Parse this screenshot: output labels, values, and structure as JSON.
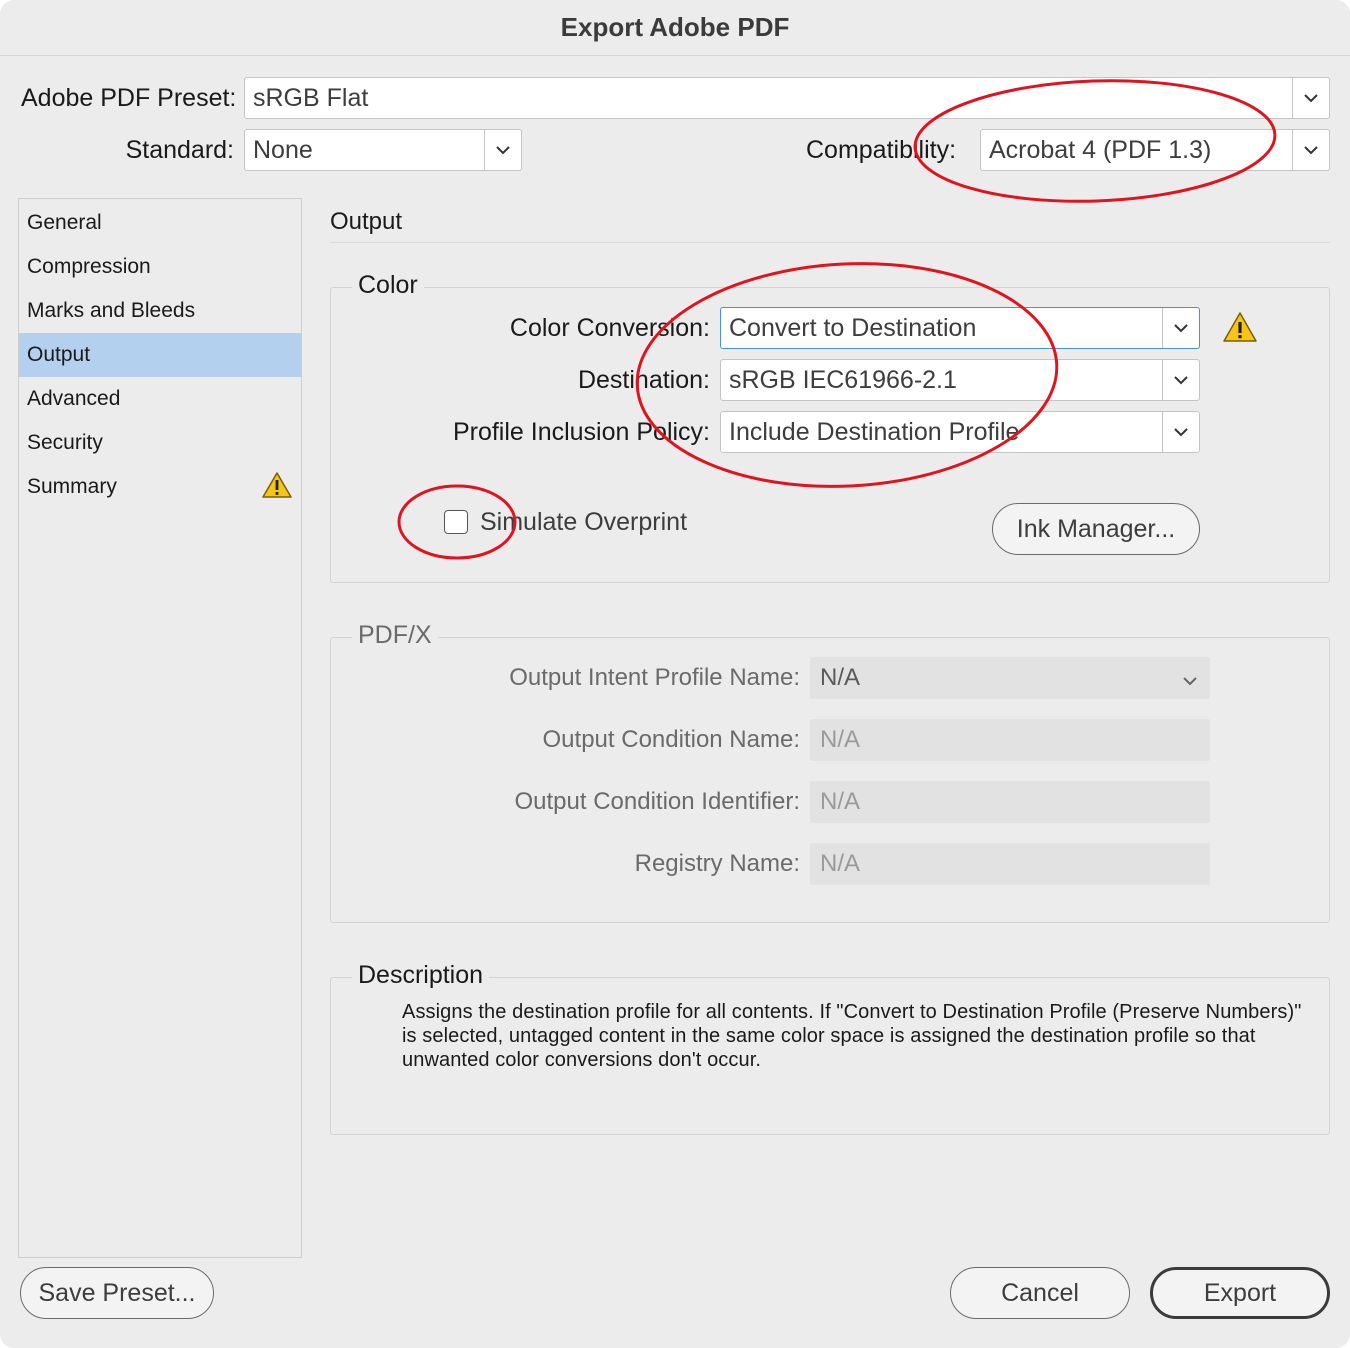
{
  "window": {
    "title": "Export Adobe PDF"
  },
  "preset": {
    "label": "Adobe PDF Preset:",
    "value": "sRGB Flat"
  },
  "standard": {
    "label": "Standard:",
    "value": "None"
  },
  "compatibility": {
    "label": "Compatibility:",
    "value": "Acrobat 4 (PDF 1.3)"
  },
  "sidebar": {
    "items": [
      {
        "label": "General"
      },
      {
        "label": "Compression"
      },
      {
        "label": "Marks and Bleeds"
      },
      {
        "label": "Output",
        "selected": true
      },
      {
        "label": "Advanced"
      },
      {
        "label": "Security"
      },
      {
        "label": "Summary",
        "warning": true
      }
    ]
  },
  "main": {
    "title": "Output",
    "color": {
      "legend": "Color",
      "conversion": {
        "label": "Color Conversion:",
        "value": "Convert to Destination"
      },
      "destination": {
        "label": "Destination:",
        "value": "sRGB IEC61966-2.1"
      },
      "policy": {
        "label": "Profile Inclusion Policy:",
        "value": "Include Destination Profile"
      },
      "simulate_overprint": {
        "label": "Simulate Overprint",
        "checked": false
      },
      "ink_manager": "Ink Manager..."
    },
    "pdfx": {
      "legend": "PDF/X",
      "intent": {
        "label": "Output Intent Profile Name:",
        "value": "N/A"
      },
      "condition_name": {
        "label": "Output Condition Name:",
        "value": "N/A"
      },
      "condition_id": {
        "label": "Output Condition Identifier:",
        "value": "N/A"
      },
      "registry": {
        "label": "Registry Name:",
        "value": "N/A"
      }
    },
    "description": {
      "legend": "Description",
      "text": "Assigns the destination profile for all contents. If \"Convert to Destination Profile (Preserve Numbers)\" is selected, untagged content in the same color space is assigned the destination profile so that unwanted color conversions don't occur."
    }
  },
  "footer": {
    "save_preset": "Save Preset...",
    "cancel": "Cancel",
    "export": "Export"
  },
  "colors": {
    "selection": "#b4d0ef",
    "focus_ring": "#4a8fde",
    "warning": "#f5c518",
    "annotation": "#e0141e"
  },
  "icons": [
    "chevron-down-icon",
    "warning-icon"
  ]
}
